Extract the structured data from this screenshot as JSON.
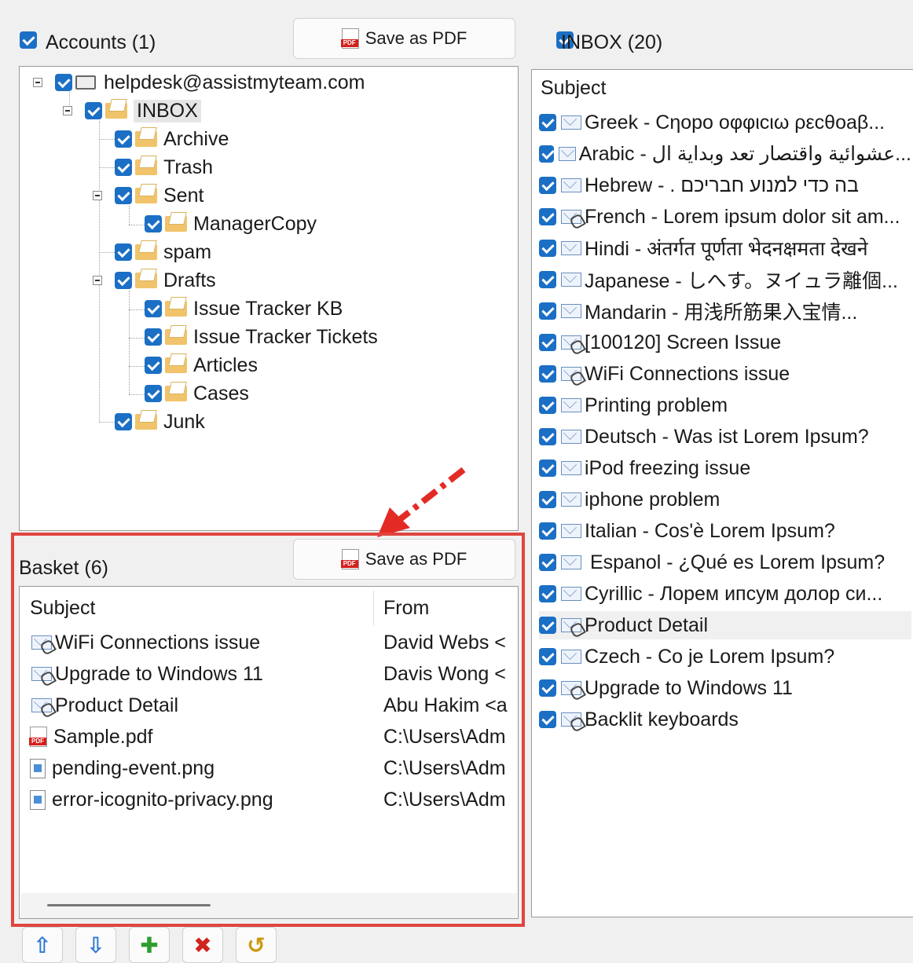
{
  "accounts_panel": {
    "header": "Accounts (1)",
    "save_pdf_label": "Save as PDF",
    "tree": {
      "account": "helpdesk@assistmyteam.com",
      "inbox": "INBOX",
      "folders": {
        "archive": "Archive",
        "trash": "Trash",
        "sent": "Sent",
        "manager_copy": "ManagerCopy",
        "spam": "spam",
        "drafts": "Drafts",
        "issue_tracker_kb": "Issue Tracker KB",
        "issue_tracker_tickets": "Issue Tracker Tickets",
        "articles": "Articles",
        "cases": "Cases",
        "junk": "Junk"
      }
    }
  },
  "basket_panel": {
    "header": "Basket (6)",
    "save_pdf_label": "Save as PDF",
    "columns": {
      "subject": "Subject",
      "from": "From"
    },
    "rows": [
      {
        "subject": "WiFi Connections issue",
        "from": "David Webs <",
        "icon": "email-attachment-icon"
      },
      {
        "subject": "Upgrade to Windows 11",
        "from": "Davis Wong <",
        "icon": "email-attachment-icon"
      },
      {
        "subject": "Product Detail",
        "from": "Abu Hakim <a",
        "icon": "email-attachment-icon"
      },
      {
        "subject": "Sample.pdf",
        "from": "C:\\Users\\Adm",
        "icon": "pdf-file-icon"
      },
      {
        "subject": "pending-event.png",
        "from": "C:\\Users\\Adm",
        "icon": "image-file-icon"
      },
      {
        "subject": "error-icognito-privacy.png",
        "from": "C:\\Users\\Adm",
        "icon": "image-file-icon"
      }
    ]
  },
  "inbox_panel": {
    "header": "INBOX (20)",
    "column_subject": "Subject",
    "messages": [
      {
        "subject": "Greek - Cηοpo οφφιcιω ρεcθoaβ...",
        "icon": "email-icon"
      },
      {
        "subject": "Arabic - عشوائية واقتصار تعد وبداية ال...",
        "icon": "email-icon"
      },
      {
        "subject": "Hebrew - . בה כדי למנוע חבריכם",
        "icon": "email-icon"
      },
      {
        "subject": "French - Lorem ipsum dolor sit am...",
        "icon": "email-attachment-icon"
      },
      {
        "subject": "Hindi - अंतर्गत पूर्णता भेदनक्षमता देखने",
        "icon": "email-icon"
      },
      {
        "subject": "Japanese - しへす。ヌイュラ離個...",
        "icon": "email-icon"
      },
      {
        "subject": "Mandarin - 用浅所筋果入宝情...",
        "icon": "email-icon"
      },
      {
        "subject": "[100120] Screen Issue",
        "icon": "email-attachment-icon"
      },
      {
        "subject": "WiFi Connections issue",
        "icon": "email-attachment-icon"
      },
      {
        "subject": "Printing problem",
        "icon": "email-icon"
      },
      {
        "subject": "Deutsch - Was ist Lorem Ipsum?",
        "icon": "email-icon"
      },
      {
        "subject": "iPod freezing issue",
        "icon": "email-icon"
      },
      {
        "subject": "iphone problem",
        "icon": "email-icon"
      },
      {
        "subject": "Italian - Cos'è Lorem Ipsum?",
        "icon": "email-icon"
      },
      {
        "subject": " Espanol - ¿Qué es Lorem Ipsum?",
        "icon": "email-icon"
      },
      {
        "subject": "Cyrillic - Лорем ипсум долор си...",
        "icon": "email-icon"
      },
      {
        "subject": "Product Detail",
        "icon": "email-attachment-icon"
      },
      {
        "subject": "Czech - Co je Lorem Ipsum?",
        "icon": "email-icon"
      },
      {
        "subject": "Upgrade to Windows 11",
        "icon": "email-attachment-icon"
      },
      {
        "subject": "Backlit keyboards",
        "icon": "email-attachment-icon"
      }
    ]
  },
  "toolbar": {
    "buttons": [
      "move-up",
      "move-down",
      "add",
      "remove",
      "clear"
    ]
  },
  "colors": {
    "checkbox": "#1b6fc4",
    "highlight_border": "#e0453f",
    "arrow": "#e32b25"
  }
}
